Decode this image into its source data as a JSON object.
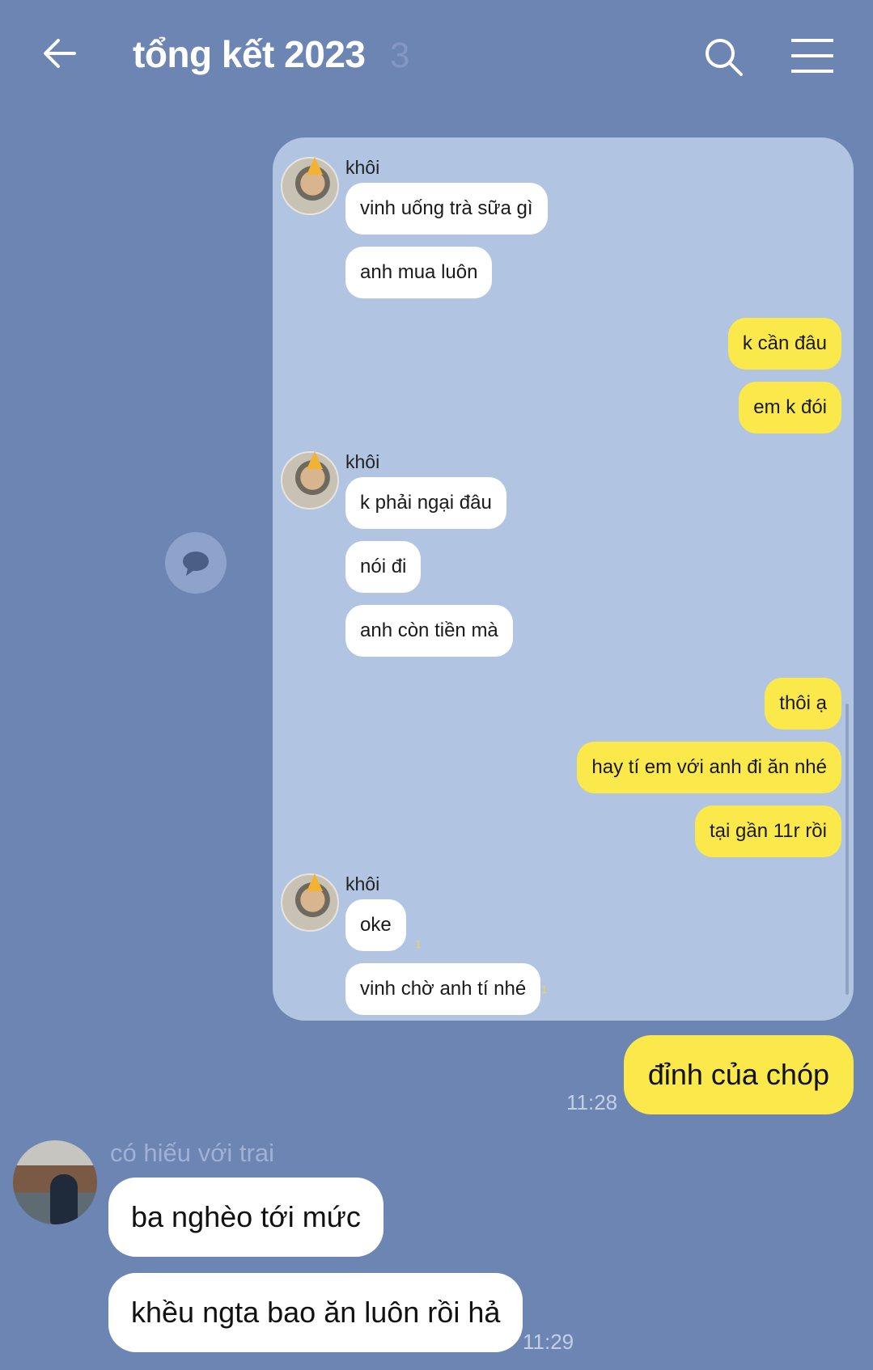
{
  "header": {
    "title": "tổng kết 2023",
    "member_count": "3",
    "icons": [
      "back-arrow-icon",
      "search-icon",
      "menu-icon"
    ]
  },
  "embedded_screenshot": {
    "sender": "khôi",
    "messages": [
      {
        "from": "khôi",
        "text": "vinh uống trà sữa gì"
      },
      {
        "from": "khôi",
        "text": "anh mua luôn"
      },
      {
        "from": "me",
        "text": "k cần đâu"
      },
      {
        "from": "me",
        "text": "em k đói"
      },
      {
        "from": "khôi",
        "text": "k phải ngại đâu"
      },
      {
        "from": "khôi",
        "text": "nói đi"
      },
      {
        "from": "khôi",
        "text": "anh còn tiền mà"
      },
      {
        "from": "me",
        "text": "thôi ạ"
      },
      {
        "from": "me",
        "text": "hay tí em với anh đi ăn nhé"
      },
      {
        "from": "me",
        "text": "tại gần 11r rồi"
      },
      {
        "from": "khôi",
        "text": "oke",
        "unread": "1"
      },
      {
        "from": "khôi",
        "text": "vinh chờ anh tí nhé",
        "unread": "1"
      }
    ]
  },
  "chat": {
    "outgoing": {
      "text": "đỉnh của chóp",
      "time": "11:28"
    },
    "incoming": {
      "sender": "có hiếu với trai",
      "messages": [
        "ba nghèo tới mức",
        "khều ngta bao ăn luôn rồi hả"
      ],
      "time": "11:29"
    }
  },
  "colors": {
    "background": "#6c85b3",
    "panel": "#b1c5e3",
    "my_bubble": "#fbe84a",
    "their_bubble": "#ffffff"
  }
}
